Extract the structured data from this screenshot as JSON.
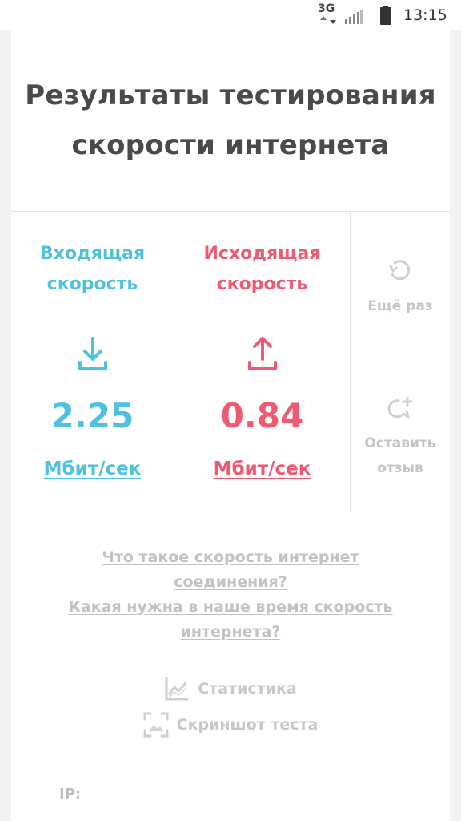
{
  "status_bar": {
    "network": "3G",
    "time": "13:15",
    "icons": [
      "data-arrows-icon",
      "signal-icon",
      "battery-icon"
    ]
  },
  "page": {
    "title": "Результаты тестирования скорости интернета"
  },
  "download": {
    "label": "Входящая скорость",
    "value": "2.25",
    "unit": "Мбит/сек",
    "icon": "download-icon",
    "color": "#4fc1e0"
  },
  "upload": {
    "label": "Исходящая скорость",
    "value": "0.84",
    "unit": "Мбит/сек",
    "icon": "upload-icon",
    "color": "#ee5a72"
  },
  "actions": {
    "retry_label": "Ещё раз",
    "retry_icon": "refresh-icon",
    "feedback_label": "Оставить отзыв",
    "feedback_icon": "chat-add-icon"
  },
  "links": {
    "what_is_speed": "Что такое скорость интернет соединения?",
    "needed_speed": "Какая нужна в наше время скорость интернета?"
  },
  "tools": {
    "statistics_label": "Статистика",
    "statistics_icon": "chart-icon",
    "screenshot_label": "Скриншот теста",
    "screenshot_icon": "screenshot-icon"
  },
  "info": {
    "ip_label": "IP:"
  }
}
